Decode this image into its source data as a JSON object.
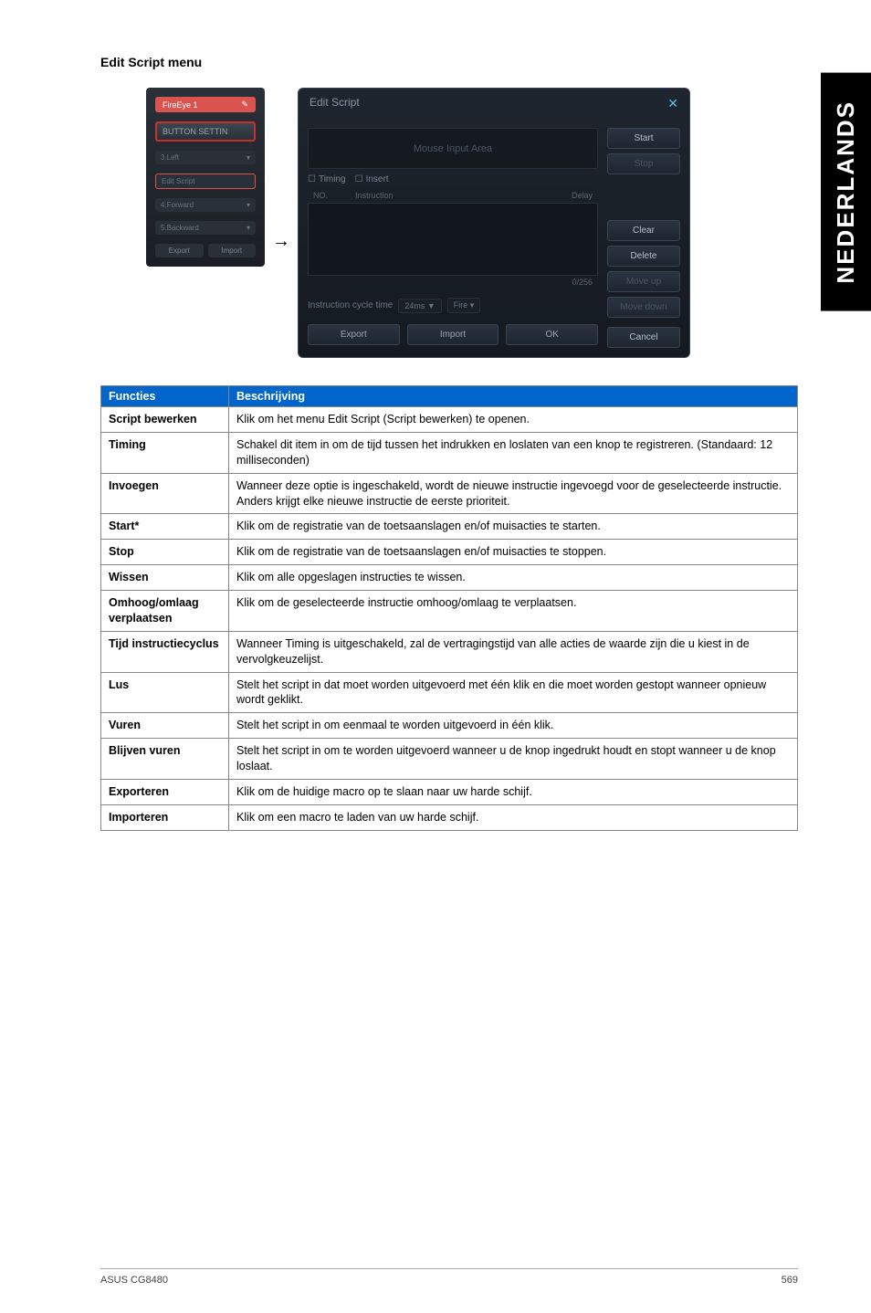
{
  "side_tab": "NEDERLANDS",
  "section_title": "Edit Script menu",
  "panel_left": {
    "profile": "FireEye 1",
    "banner": "BUTTON SETTIN",
    "row1": "3.Left",
    "row1_sub": "Edit Script",
    "row2": "4.Forward",
    "row3": "5.Backward",
    "export": "Export",
    "import": "Import"
  },
  "dialog": {
    "title": "Edit Script",
    "input_area": "Mouse Input Area",
    "tab_timing": "Timing",
    "tab_insert": "Insert",
    "col_no": "NO.",
    "col_instruction": "Instruction",
    "col_delay": "Delay",
    "counter": "0/256",
    "cycle_label": "Instruction cycle time",
    "cycle_val": "24ms ▼",
    "cycle_fire": "Fire",
    "btn_export": "Export",
    "btn_import": "Import",
    "btn_ok": "OK",
    "side": {
      "start": "Start",
      "stop": "Stop",
      "clear": "Clear",
      "delete": "Delete",
      "moveup": "Move up",
      "movedown": "Move down",
      "cancel": "Cancel"
    }
  },
  "table": {
    "head_func": "Functies",
    "head_desc": "Beschrijving",
    "rows": [
      {
        "f": "Script bewerken",
        "d": "Klik om het menu Edit Script (Script bewerken) te openen."
      },
      {
        "f": "Timing",
        "d": "Schakel dit item in om de tijd tussen het indrukken en loslaten van een knop te registreren. (Standaard: 12 milliseconden)"
      },
      {
        "f": "Invoegen",
        "d": "Wanneer deze optie is ingeschakeld, wordt de nieuwe instructie ingevoegd voor de geselecteerde instructie. Anders krijgt elke nieuwe instructie de eerste prioriteit."
      },
      {
        "f": "Start*",
        "d": "Klik om de registratie van de toetsaanslagen en/of muisacties te starten."
      },
      {
        "f": "Stop",
        "d": "Klik om de registratie van de toetsaanslagen en/of muisacties te stoppen."
      },
      {
        "f": "Wissen",
        "d": "Klik om alle opgeslagen instructies te wissen."
      },
      {
        "f": "Omhoog/omlaag verplaatsen",
        "d": "Klik om de geselecteerde instructie omhoog/omlaag te verplaatsen."
      },
      {
        "f": "Tijd instructiecyclus",
        "d": "Wanneer Timing is uitgeschakeld, zal de vertragingstijd van alle acties de waarde zijn die u kiest in de vervolgkeuzelijst."
      },
      {
        "f": "Lus",
        "d": "Stelt het script in dat moet worden uitgevoerd met één klik en die moet worden gestopt wanneer opnieuw wordt geklikt."
      },
      {
        "f": "Vuren",
        "d": "Stelt het script in om eenmaal te worden uitgevoerd in één klik."
      },
      {
        "f": "Blijven vuren",
        "d": "Stelt het script in om te worden uitgevoerd wanneer u de knop ingedrukt houdt en stopt wanneer u de knop loslaat."
      },
      {
        "f": "Exporteren",
        "d": "Klik om de huidige macro op te slaan naar uw harde schijf."
      },
      {
        "f": "Importeren",
        "d": "Klik om een macro te laden van uw harde schijf."
      }
    ]
  },
  "footer": {
    "left": "ASUS CG8480",
    "right": "569"
  }
}
